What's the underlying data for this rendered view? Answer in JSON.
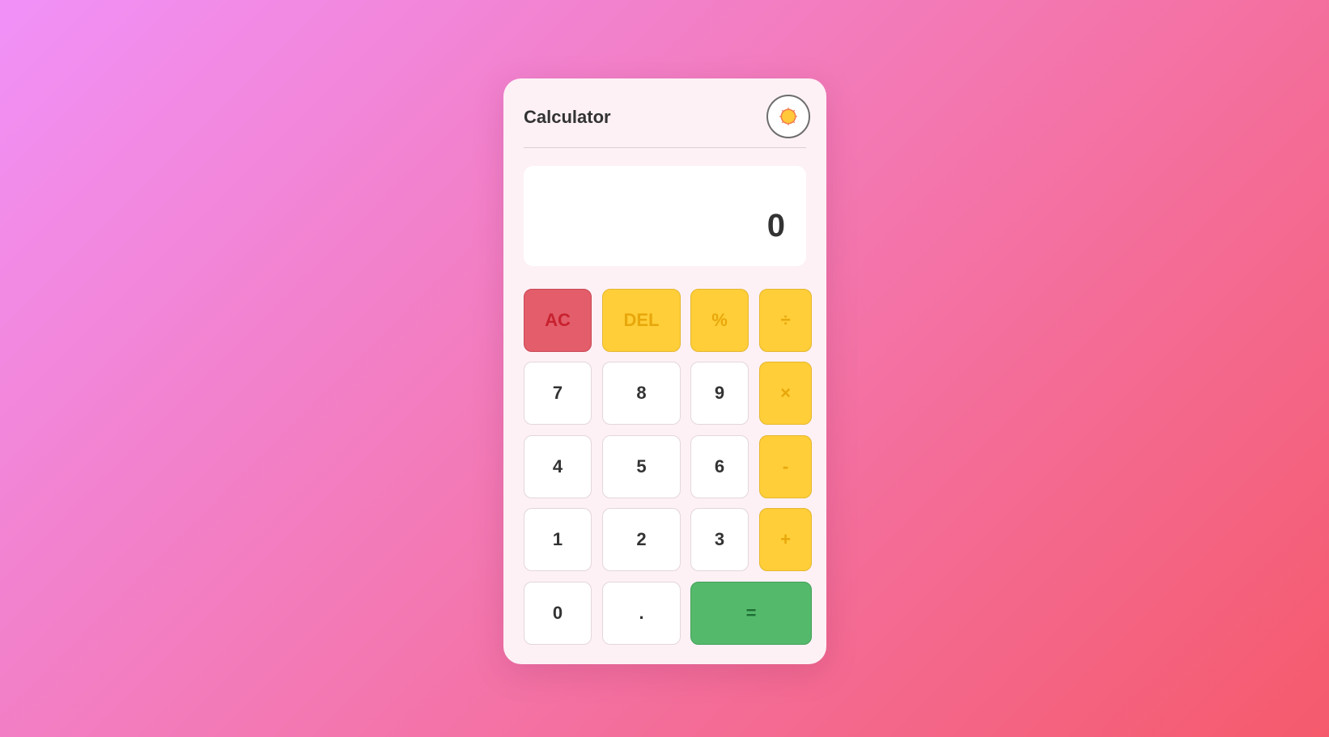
{
  "app": {
    "title": "Calculator",
    "theme_toggle_icon": "sun-icon"
  },
  "display": {
    "value": "0"
  },
  "keypad": {
    "rows": [
      [
        "AC",
        "DEL",
        "%",
        "÷"
      ],
      [
        "7",
        "8",
        "9",
        "×"
      ],
      [
        "4",
        "5",
        "6",
        "-"
      ],
      [
        "1",
        "2",
        "3",
        "+"
      ],
      [
        "0",
        ".",
        "="
      ]
    ]
  },
  "colors": {
    "card_background": "#fdf1f6",
    "operator": "#ffce38",
    "clear": "#e35d6a",
    "equals": "#55b96b",
    "number": "#ffffff"
  }
}
